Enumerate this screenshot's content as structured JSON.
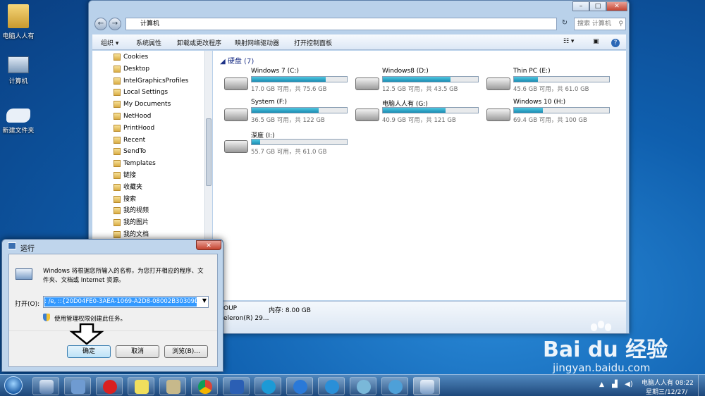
{
  "desktop": {
    "icons": [
      {
        "label": "电脑人人有",
        "icon": "user-folder-icon"
      },
      {
        "label": "计算机",
        "icon": "computer-icon"
      },
      {
        "label": "新建文件夹",
        "icon": "folder-icon"
      }
    ]
  },
  "explorer": {
    "address": "计算机",
    "search_placeholder": "搜索 计算机",
    "toolbar": [
      "组织 ▾",
      "系统属性",
      "卸载或更改程序",
      "映射网络驱动器",
      "打开控制面板"
    ],
    "nav_items": [
      "Cookies",
      "Desktop",
      "IntelGraphicsProfiles",
      "Local Settings",
      "My Documents",
      "NetHood",
      "PrintHood",
      "Recent",
      "SendTo",
      "Templates",
      "链接",
      "收藏夹",
      "搜索",
      "我的视频",
      "我的图片",
      "我的文档"
    ],
    "group_label": "硬盘 (7)",
    "drives": [
      {
        "name": "Windows 7  (C:)",
        "info": "17.0 GB 可用，共 75.6 GB",
        "used": 0.775
      },
      {
        "name": "Windows8 (D:)",
        "info": "12.5 GB 可用，共 43.5 GB",
        "used": 0.713
      },
      {
        "name": "Thin PC (E:)",
        "info": "45.6 GB 可用，共 61.0 GB",
        "used": 0.252
      },
      {
        "name": "System (F:)",
        "info": "36.5 GB 可用，共 122 GB",
        "used": 0.701
      },
      {
        "name": "电脑人人有 (G:)",
        "info": "40.9 GB 可用，共 121 GB",
        "used": 0.662
      },
      {
        "name": "Windows 10 (H:)",
        "info": "69.4 GB 可用，共 100 GB",
        "used": 0.306
      },
      {
        "name": "深度 (I:)",
        "info": "55.7 GB 可用，共 61.0 GB",
        "used": 0.087
      }
    ],
    "details": {
      "workgroup": "OUP",
      "memory": "内存: 8.00 GB",
      "cpu": "eleron(R) 29..."
    }
  },
  "run_dialog": {
    "title": "运行",
    "description": "Windows 将根据您所输入的名称，为您打开相应的程序、文件夹、文档或 Internet 资源。",
    "open_label": "打开(O):",
    "command": ": /e, ::{20D04FE0-3AEA-1069-A2D8-08002B30309D}",
    "admin_note": "使用管理权限创建此任务。",
    "ok": "确定",
    "cancel": "取消",
    "browse": "浏览(B)..."
  },
  "taskbar": {
    "clock_user": "电脑人人有 08:22",
    "clock_date": "星期三/12/27/"
  },
  "watermark": {
    "brand": "Bai du 经验",
    "url": "jingyan.baidu.com"
  }
}
